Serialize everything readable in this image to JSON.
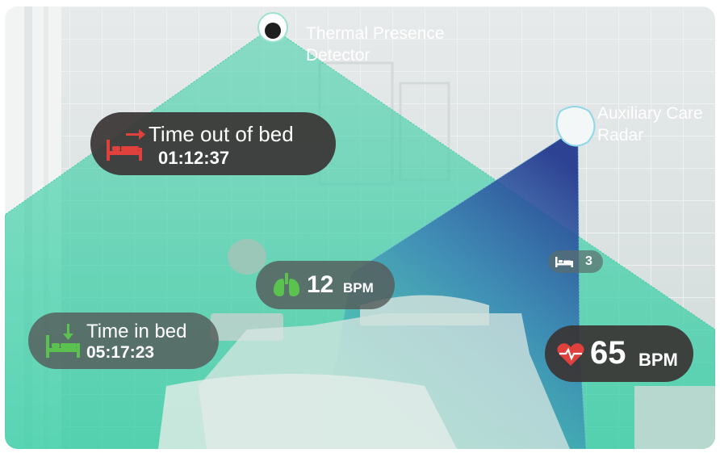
{
  "devices": {
    "thermal_label": "Thermal Presence Detector",
    "thermal_line1": "Thermal Presence",
    "thermal_line2": "Detector",
    "radar_label": "Auxiliary Care Radar",
    "radar_line1": "Auxiliary Care",
    "radar_line2": "Radar"
  },
  "cards": {
    "out_of_bed": {
      "title": "Time out of bed",
      "value": "01:12:37",
      "icon": "bed-exit-icon",
      "icon_color": "#e0413c"
    },
    "in_bed": {
      "title": "Time in bed",
      "value": "05:17:23",
      "icon": "bed-enter-icon",
      "icon_color": "#5cc24f"
    },
    "respiration": {
      "value": "12",
      "unit": "BPM",
      "icon": "lungs-icon",
      "icon_color": "#5cc24f"
    },
    "heart_rate": {
      "value": "65",
      "unit": "BPM",
      "icon": "heart-pulse-icon",
      "icon_color": "#e0413c"
    },
    "bed_count": {
      "value": "3",
      "icon": "bed-icon"
    }
  },
  "colors": {
    "thermal_beam": "#3ecfa7",
    "radar_beam": "#2c3a8c"
  }
}
